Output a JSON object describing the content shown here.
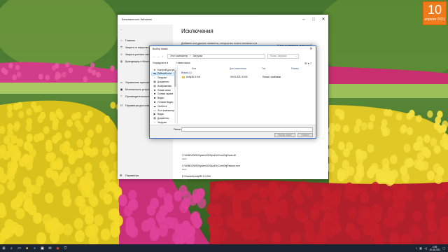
{
  "desktop": {
    "calendar": {
      "day": "10",
      "month": "апреля 2021"
    }
  },
  "settings_window": {
    "title": "Безопасность Windows",
    "nav": [
      {
        "icon": "home-icon",
        "glyph": "⌂",
        "label": "Главная"
      },
      {
        "icon": "shield-icon",
        "glyph": "⛉",
        "label": "Защита от вирусов и угроз"
      },
      {
        "icon": "person-icon",
        "glyph": "☺",
        "label": "Защита учетных записей"
      },
      {
        "icon": "network-icon",
        "glyph": "◍",
        "label": "Брандмауэр и безопасность сети"
      },
      {
        "icon": "app-browser-icon",
        "glyph": "▭",
        "label": "Управление приложениями/браузером"
      },
      {
        "icon": "device-security-icon",
        "glyph": "▣",
        "label": "Безопасность устройства"
      },
      {
        "icon": "health-icon",
        "glyph": "♡",
        "label": "Производительность и работоспособность устройства"
      },
      {
        "icon": "family-icon",
        "glyph": "☷",
        "label": "Параметры для семьи"
      }
    ],
    "settings_link": {
      "icon": "gear-icon",
      "glyph": "⚙",
      "label": "Параметры"
    },
    "heading": "Исключения",
    "description": "Добавьте или удалите элементы, которые вы хотите исключить из проверки антивирусной программы Microsoft Defender.",
    "question": "У вас появились вопросы?",
    "help_link": "Получить помощь",
    "exclusions": [
      {
        "path": "C:\\WINDOWS\\System32\\GpuEx\\ComObjHook.dll",
        "type": "Файл"
      },
      {
        "path": "C:\\WINDOWS\\System32\\GpuEx\\ComObjPatcher.exe",
        "type": "Файл"
      },
      {
        "path": "E:\\Games\\Unity3D 5.3.0f4",
        "type": "Папка"
      }
    ]
  },
  "folder_dialog": {
    "title": "Выбор папки",
    "breadcrumb": [
      "Этот компьютер",
      "Загрузки"
    ],
    "search_placeholder": "Поиск: Загрузки",
    "toolbar": {
      "organize": "Упорядочить ▾",
      "new_folder": "Новая папка"
    },
    "tree": [
      {
        "icon": "star-icon",
        "glyph": "★",
        "label": "Быстрый доступ",
        "selected": false
      },
      {
        "icon": "desktop-icon",
        "glyph": "▬",
        "label": "Рабочий стол",
        "selected": true
      },
      {
        "icon": "download-icon",
        "glyph": "↓",
        "label": "Загрузки",
        "selected": false
      },
      {
        "icon": "documents-icon",
        "glyph": "▤",
        "label": "Документы",
        "selected": false
      },
      {
        "icon": "pictures-icon",
        "glyph": "▨",
        "label": "Изображения",
        "selected": false
      },
      {
        "icon": "folder-icon",
        "glyph": "■",
        "label": "Новая папка",
        "selected": false
      },
      {
        "icon": "folder-icon",
        "glyph": "■",
        "label": "Снимки экрана",
        "selected": false
      },
      {
        "icon": "folder-icon",
        "glyph": "■",
        "label": "Видео",
        "selected": false
      },
      {
        "icon": "folder-icon",
        "glyph": "■",
        "label": "Готовые Видео",
        "selected": false
      },
      {
        "icon": "onedrive-icon",
        "glyph": "☁",
        "label": "OneDrive",
        "selected": false
      },
      {
        "icon": "computer-icon",
        "glyph": "▭",
        "label": "Этот компьютер",
        "selected": false
      },
      {
        "icon": "video-icon",
        "glyph": "▶",
        "label": "Видео",
        "selected": false
      },
      {
        "icon": "documents-icon",
        "glyph": "▤",
        "label": "Документы",
        "selected": false
      },
      {
        "icon": "download-icon",
        "glyph": "↓",
        "label": "Загрузки",
        "selected": false
      }
    ],
    "columns": {
      "name": "Имя",
      "date": "Дата изменения",
      "type": "Тип",
      "size": "Размер"
    },
    "group": "Вчера (1)",
    "rows": [
      {
        "name": "Unity3D 5.6.f4",
        "date": "09.04.2021 19:51",
        "type": "Папка с файлами"
      }
    ],
    "folder_label": "Папка:",
    "select_button": "Выбор папки",
    "cancel_button": "Отмена"
  },
  "taskbar": {
    "clock_time": "0:59",
    "clock_date": "10.04.2021"
  }
}
